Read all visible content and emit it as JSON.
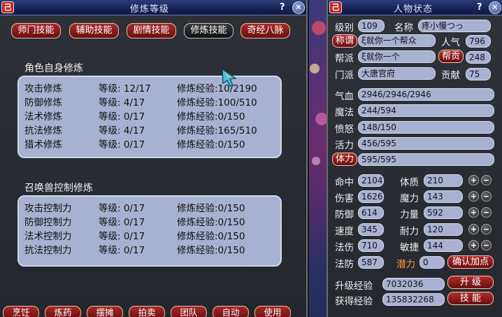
{
  "left_window": {
    "title": "修炼等级",
    "badge": "己",
    "help": "?",
    "close": "✕",
    "tabs": [
      "师门技能",
      "辅助技能",
      "剧情技能",
      "修炼技能",
      "奇经八脉"
    ],
    "self_section": {
      "title": "角色自身修炼",
      "rows": [
        {
          "name": "攻击修炼",
          "level": "等级: 12/17",
          "exp": "修炼经验:10/2190"
        },
        {
          "name": "防御修炼",
          "level": "等级:  4/17",
          "exp": "修炼经验:100/510"
        },
        {
          "name": "法术修炼",
          "level": "等级:  0/17",
          "exp": "修炼经验:0/150"
        },
        {
          "name": "抗法修炼",
          "level": "等级:  4/17",
          "exp": "修炼经验:165/510"
        },
        {
          "name": "猎术修炼",
          "level": "等级:  0/17",
          "exp": "修炼经验:0/150"
        }
      ]
    },
    "pet_section": {
      "title": "召唤兽控制修炼",
      "rows": [
        {
          "name": "攻击控制力",
          "level": "等级:  0/17",
          "exp": "修炼经验:0/150"
        },
        {
          "name": "防御控制力",
          "level": "等级:  0/17",
          "exp": "修炼经验:0/150"
        },
        {
          "name": "法术控制力",
          "level": "等级:  0/17",
          "exp": "修炼经验:0/150"
        },
        {
          "name": "抗法控制力",
          "level": "等级:  0/17",
          "exp": "修炼经验:0/150"
        }
      ]
    },
    "bottom_buttons": [
      "烹饪",
      "炼药",
      "摆摊",
      "拍卖",
      "团队",
      "自动",
      "使用"
    ]
  },
  "right_window": {
    "title": "人物状态",
    "badge": "己",
    "help": "?",
    "close": "✕",
    "level_label": "级别",
    "level_value": "109",
    "name_label": "名称",
    "name_value": "疼小慢つっ",
    "title_btn": "称谓",
    "title_value": "ξ就你一个帮众",
    "pop_label": "人气",
    "pop_value": "796",
    "guild_label": "帮派",
    "guild_value": "ξ就你一个",
    "guild_btn": "帮贡",
    "guild_contrib_value": "248",
    "school_label": "门派",
    "school_value": "大唐官府",
    "contrib_label": "贡献",
    "contrib_value": "75",
    "hp_label": "气血",
    "hp_value": "2946/2946/2946",
    "mp_label": "魔法",
    "mp_value": "244/594",
    "rage_label": "愤怒",
    "rage_value": "148/150",
    "vit_label": "活力",
    "vit_value": "456/595",
    "stam_btn": "体力",
    "stam_value": "595/595",
    "stats": [
      {
        "label": "命中",
        "value": "2104",
        "attr": "体质",
        "attr_value": "210"
      },
      {
        "label": "伤害",
        "value": "1626",
        "attr": "魔力",
        "attr_value": "143"
      },
      {
        "label": "防御",
        "value": "614",
        "attr": "力量",
        "attr_value": "592"
      },
      {
        "label": "速度",
        "value": "345",
        "attr": "耐力",
        "attr_value": "120"
      },
      {
        "label": "法伤",
        "value": "710",
        "attr": "敏捷",
        "attr_value": "144"
      }
    ],
    "mdef_label": "法防",
    "mdef_value": "587",
    "potential_label": "潜力",
    "potential_value": "0",
    "confirm_btn": "确认加点",
    "upgrade_exp_label": "升级经验",
    "upgrade_exp_value": "7032036",
    "upgrade_btn": "升 级",
    "gained_exp_label": "获得经验",
    "gained_exp_value": "135832268",
    "skill_btn": "技 能",
    "plus": "+",
    "minus": "−"
  }
}
